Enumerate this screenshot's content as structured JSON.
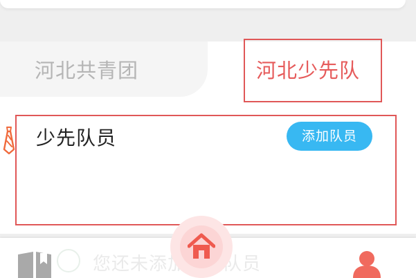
{
  "tabs": {
    "inactive_label": "河北共青团",
    "active_label": "河北少先队"
  },
  "section": {
    "title": "少先队员",
    "add_button_label": "添加队员"
  },
  "bottom_nav": {
    "faded_text": "您还未添加少先队员"
  },
  "colors": {
    "active_tab": "#e65b5b",
    "add_button": "#38b8f2",
    "highlight_border": "#e05757",
    "nav_active": "#f06a5e"
  },
  "icons": {
    "tie": "tie-icon",
    "book": "book-icon",
    "home": "home-icon",
    "user": "user-icon"
  }
}
